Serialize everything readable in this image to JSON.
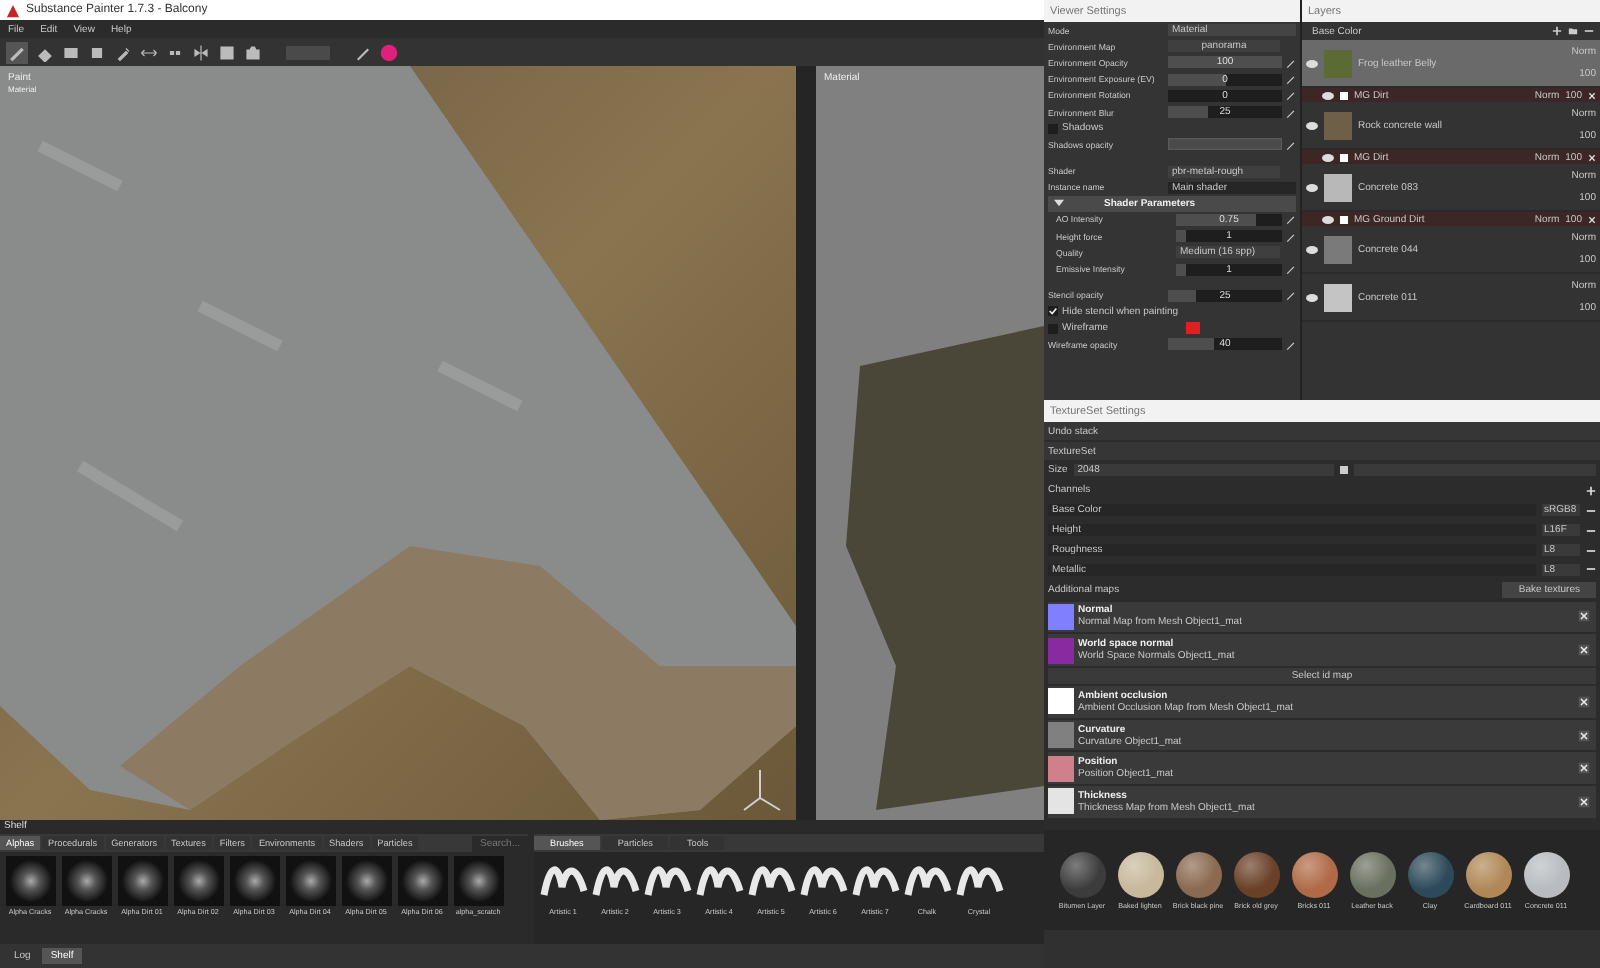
{
  "window": {
    "title": "Substance Painter 1.7.3 - Balcony"
  },
  "menu": [
    "File",
    "Edit",
    "View",
    "Help"
  ],
  "viewport_3d": {
    "label": "Paint",
    "sublabel": "Material"
  },
  "viewport_2d": {
    "label": "Material"
  },
  "viewer_settings": {
    "title": "Viewer Settings",
    "mode_label": "Mode",
    "mode": "Material",
    "rows": [
      {
        "kind": "button",
        "label": "Environment Map",
        "value": "panorama"
      },
      {
        "kind": "slider",
        "label": "Environment Opacity",
        "value": "100",
        "level": 1
      },
      {
        "kind": "slider",
        "label": "Environment Exposure (EV)",
        "value": "0",
        "level": 0.5
      },
      {
        "kind": "field",
        "label": "Environment Rotation",
        "value": "0",
        "disabled": false
      },
      {
        "kind": "slider",
        "label": "Environment Blur",
        "value": "25",
        "level": 0.35
      },
      {
        "kind": "checkbox",
        "label": "Shadows",
        "checked": false
      },
      {
        "kind": "field",
        "label": "Shadows opacity",
        "disabled": true
      },
      {
        "kind": "gap"
      },
      {
        "kind": "select",
        "label": "Shader",
        "value": "pbr-metal-rough"
      },
      {
        "kind": "text",
        "label": "Instance name",
        "value": "Main shader"
      },
      {
        "kind": "header",
        "label": "Shader Parameters",
        "expanded": true,
        "children": [
          {
            "kind": "slider",
            "label": "AO Intensity",
            "value": "0.75",
            "level": 0.75
          },
          {
            "kind": "slider",
            "label": "Height force",
            "value": "1",
            "level": 0.1
          },
          {
            "kind": "select",
            "label": "Quality",
            "value": "Medium (16 spp)"
          },
          {
            "kind": "slider",
            "label": "Emissive Intensity",
            "value": "1",
            "level": 0.1
          }
        ]
      },
      {
        "kind": "gap"
      },
      {
        "kind": "slider",
        "label": "Stencil opacity",
        "value": "25",
        "level": 0.25
      },
      {
        "kind": "checkbox",
        "label": "Hide stencil when painting",
        "checked": true
      },
      {
        "kind": "color",
        "label": "Wireframe",
        "checked": false,
        "color": "#e02020"
      },
      {
        "kind": "slider",
        "label": "Wireframe opacity",
        "value": "40",
        "level": 0.4
      }
    ]
  },
  "layers": {
    "title": "Layers",
    "channel": "Base Color",
    "items": [
      {
        "name": "Frog leather Belly",
        "blend": "Norm",
        "opacity": "100",
        "selected": true,
        "color": "#5c6a34",
        "visible": true,
        "effects": [
          {
            "name": "MG Dirt",
            "blend": "Norm",
            "opacity": "100"
          }
        ]
      },
      {
        "name": "Rock concrete wall",
        "blend": "Norm",
        "opacity": "100",
        "selected": false,
        "color": "#6e6048",
        "visible": true,
        "effects": [
          {
            "name": "MG Dirt",
            "blend": "Norm",
            "opacity": "100"
          }
        ]
      },
      {
        "name": "Concrete 083",
        "blend": "Norm",
        "opacity": "100",
        "selected": false,
        "color": "#b8b8b8",
        "visible": true,
        "effects": [
          {
            "name": "MG Ground Dirt",
            "blend": "Norm",
            "opacity": "100"
          }
        ]
      },
      {
        "name": "Concrete 044",
        "blend": "Norm",
        "opacity": "100",
        "selected": false,
        "color": "#7a7a7a",
        "visible": true
      },
      {
        "name": "Concrete 011",
        "blend": "Norm",
        "opacity": "100",
        "selected": false,
        "color": "#c4c4c4",
        "visible": true
      }
    ]
  },
  "textureset": {
    "title": "TextureSet Settings",
    "undo": "Undo stack",
    "set": "TextureSet",
    "size_label": "Size",
    "size": "2048",
    "channels_label": "Channels",
    "channels": [
      {
        "name": "Base Color",
        "format": "sRGB8"
      },
      {
        "name": "Height",
        "format": "L16F"
      },
      {
        "name": "Roughness",
        "format": "L8"
      },
      {
        "name": "Metallic",
        "format": "L8"
      }
    ],
    "maps_label": "Additional maps",
    "bake": "Bake textures",
    "maps": [
      {
        "kind": "map",
        "title": "Normal",
        "subtitle": "Normal Map from Mesh Object1_mat",
        "color": "#8080ff"
      },
      {
        "kind": "map",
        "title": "World space normal",
        "subtitle": "World Space Normals Object1_mat",
        "color": "#8a2aa0"
      },
      {
        "kind": "button",
        "title": "Select id map"
      },
      {
        "kind": "map",
        "title": "Ambient occlusion",
        "subtitle": "Ambient Occlusion Map from Mesh Object1_mat",
        "color": "#ffffff"
      },
      {
        "kind": "map",
        "title": "Curvature",
        "subtitle": "Curvature Object1_mat",
        "color": "#808080"
      },
      {
        "kind": "map",
        "title": "Position",
        "subtitle": "Position Object1_mat",
        "color": "#d0808a"
      },
      {
        "kind": "map",
        "title": "Thickness",
        "subtitle": "Thickness Map from Mesh Object1_mat",
        "color": "#e4e4e4"
      }
    ]
  },
  "materials": [
    {
      "name": "Bitumen Layer",
      "color": "#3c3c3c"
    },
    {
      "name": "Baked lighten",
      "color": "#c8b89c"
    },
    {
      "name": "Brick black pine",
      "color": "#8a6a50"
    },
    {
      "name": "Brick old grey",
      "color": "#6a4028"
    },
    {
      "name": "Bricks 011",
      "color": "#b06a48"
    },
    {
      "name": "Leather back",
      "color": "#6a7060"
    },
    {
      "name": "Clay",
      "color": "#2e4a5a"
    },
    {
      "name": "Cardboard 011",
      "color": "#b08858"
    },
    {
      "name": "Concrete 011",
      "color": "#b8bcc0"
    }
  ],
  "shelf": {
    "title": "Shelf",
    "search": "Search...",
    "tabs": [
      {
        "label": "Alphas",
        "selected": true
      },
      {
        "label": "Procedurals",
        "selected": false
      },
      {
        "label": "Generators",
        "selected": false
      },
      {
        "label": "Textures",
        "selected": false
      },
      {
        "label": "Filters",
        "selected": false
      },
      {
        "label": "Environments",
        "selected": false
      },
      {
        "label": "Shaders",
        "selected": false
      },
      {
        "label": "Particles",
        "selected": false
      }
    ],
    "alphas": [
      "Alpha Cracks",
      "Alpha Cracks",
      "Alpha Dirt 01",
      "Alpha Dirt 02",
      "Alpha Dirt 03",
      "Alpha Dirt 04",
      "Alpha Dirt 05",
      "Alpha Dirt 06",
      "alpha_scratch"
    ],
    "brush_tabs": [
      {
        "label": "Brushes",
        "selected": true
      },
      {
        "label": "Particles",
        "selected": false
      },
      {
        "label": "Tools",
        "selected": false
      }
    ],
    "brushes": [
      "Artistic 1",
      "Artistic 2",
      "Artistic 3",
      "Artistic 4",
      "Artistic 5",
      "Artistic 6",
      "Artistic 7",
      "Chalk",
      "Crystal"
    ]
  },
  "bottom_tabs": [
    {
      "label": "Log",
      "selected": false
    },
    {
      "label": "Shelf",
      "selected": true
    }
  ]
}
